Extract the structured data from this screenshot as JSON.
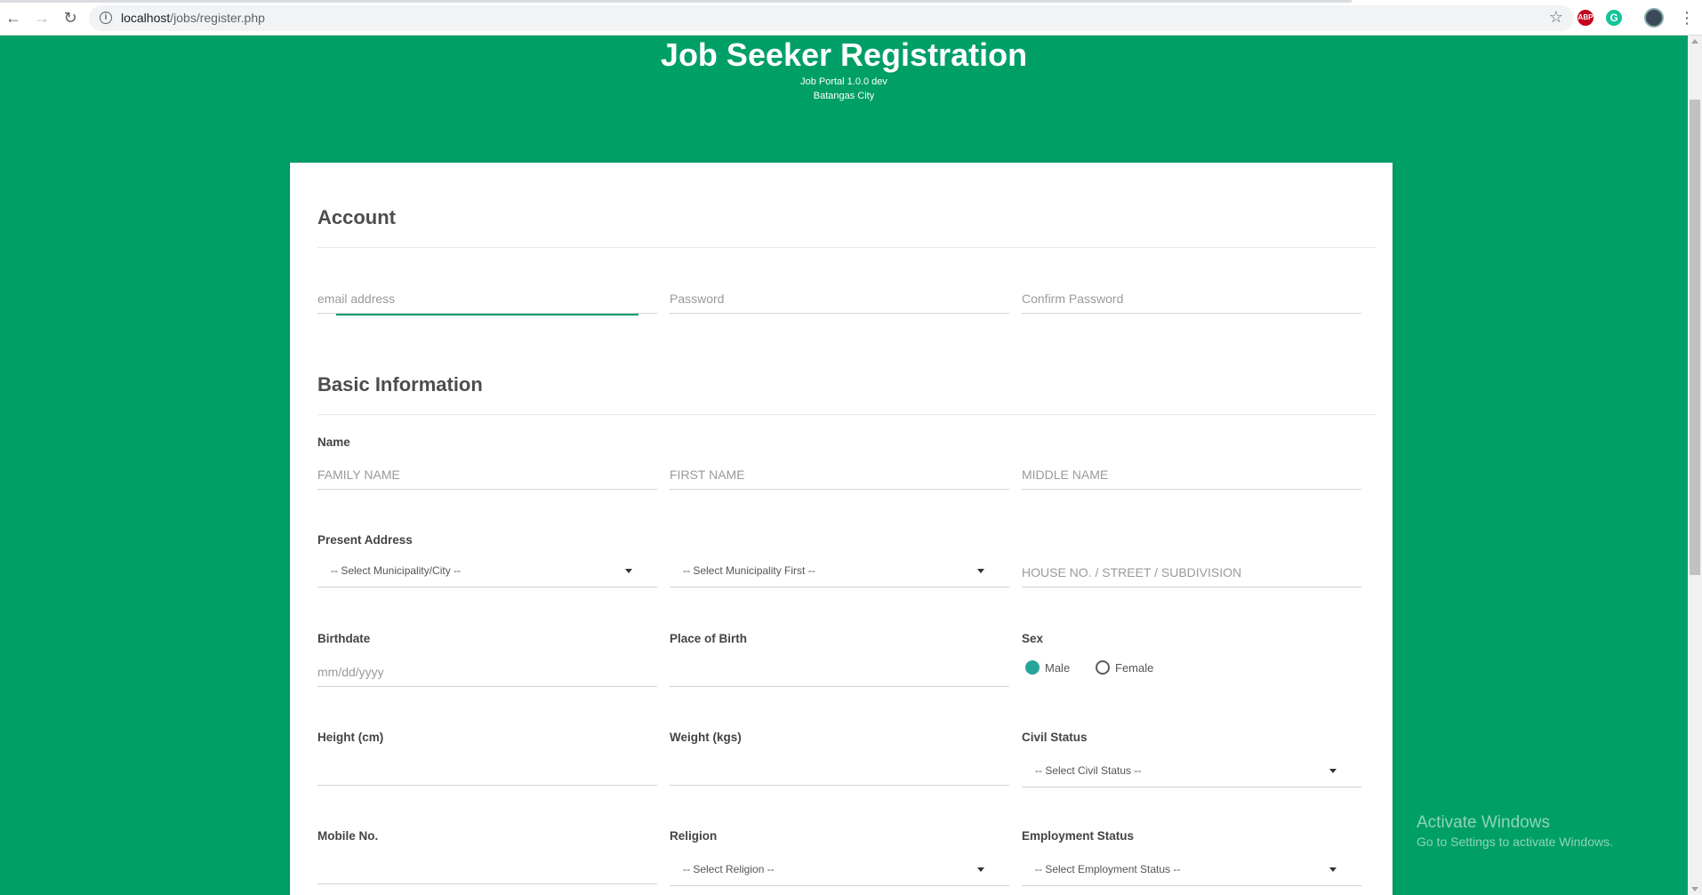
{
  "browser": {
    "url_host": "localhost",
    "url_path": "/jobs/register.php",
    "ext_abp": "ABP",
    "ext_grammarly": "G"
  },
  "header": {
    "title": "Job Seeker Registration",
    "subtitle": "Job Portal 1.0.0 dev",
    "location": "Batangas City"
  },
  "account": {
    "title": "Account",
    "email_placeholder": "email address",
    "password_placeholder": "Password",
    "confirm_placeholder": "Confirm Password"
  },
  "basic": {
    "title": "Basic Information",
    "name_label": "Name",
    "family_placeholder": "FAMILY NAME",
    "first_placeholder": "FIRST NAME",
    "middle_placeholder": "MIDDLE NAME",
    "address_label": "Present Address",
    "municipality_select": "-- Select Municipality/City --",
    "barangay_select": "-- Select Municipality First --",
    "street_placeholder": "HOUSE NO. / STREET / SUBDIVISION",
    "birthdate_label": "Birthdate",
    "birthdate_placeholder": "mm/dd/yyyy",
    "birthplace_label": "Place of Birth",
    "sex_label": "Sex",
    "sex_male": "Male",
    "sex_female": "Female",
    "sex_selected": "Male",
    "height_label": "Height (cm)",
    "weight_label": "Weight (kgs)",
    "civil_label": "Civil Status",
    "civil_select": "-- Select Civil Status --",
    "mobile_label": "Mobile No.",
    "religion_label": "Religion",
    "religion_select": "-- Select Religion --",
    "employment_label": "Employment Status",
    "employment_select": "-- Select Employment Status --"
  },
  "watermark": {
    "line1": "Activate Windows",
    "line2": "Go to Settings to activate Windows."
  },
  "colors": {
    "brand_green": "#009f67",
    "radio_checked": "#26a69a"
  }
}
